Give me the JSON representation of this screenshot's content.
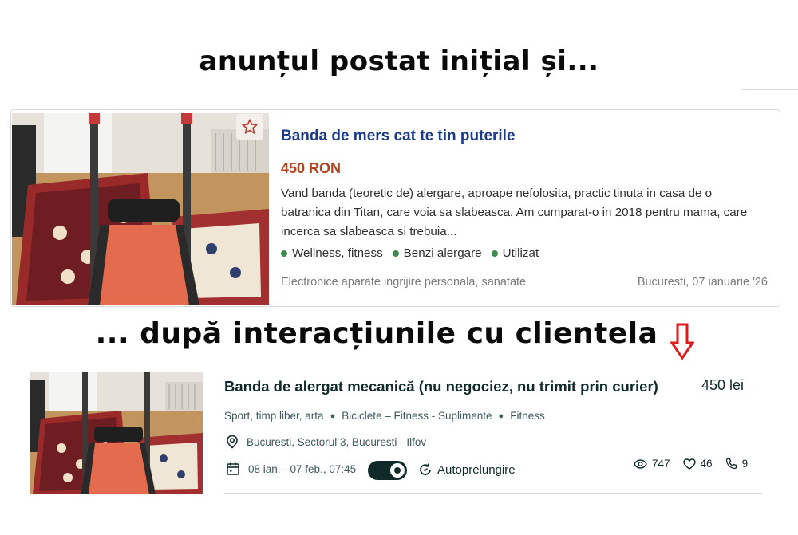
{
  "headings": {
    "before": "anunțul postat inițial și...",
    "after": "... după interacțiunile cu clientela"
  },
  "colors": {
    "accent_title": "#1b3a8c",
    "price": "#b0421f",
    "tag_dot": "#3d8a4f",
    "dark_teal": "#102a2a",
    "arrow": "#e0191b"
  },
  "original_listing": {
    "title": "Banda de mers cat te tin puterile",
    "price": "450 RON",
    "description": "Vand banda (teoretic de) alergare, aproape nefolosita, practic tinuta in casa de o batranica din Titan, care voia sa slabeasca. Am cumparat-o in 2018 pentru mama, care incerca sa slabeasca si trebuia...",
    "tags": [
      "Wellness, fitness",
      "Benzi alergare",
      "Utilizat"
    ],
    "category": "Electronice aparate ingrijire personala, sanatate",
    "location_date": "Bucuresti, 07 ianuarie '26",
    "favorite_icon": "star-icon"
  },
  "updated_listing": {
    "title": "Banda de alergat mecanică (nu negociez, nu trimit prin curier)",
    "price": "450 lei",
    "categories": [
      "Sport, timp liber, arta",
      "Biciclete – Fitness - Suplimente",
      "Fitness"
    ],
    "location": "Bucuresti, Sectorul 3, Bucuresti - Ilfov",
    "dates": "08 ian. - 07 feb., 07:45",
    "auto_renew_label": "Autoprelungire",
    "auto_renew_on": true,
    "stats": {
      "views": "747",
      "likes": "46",
      "calls": "9"
    }
  }
}
